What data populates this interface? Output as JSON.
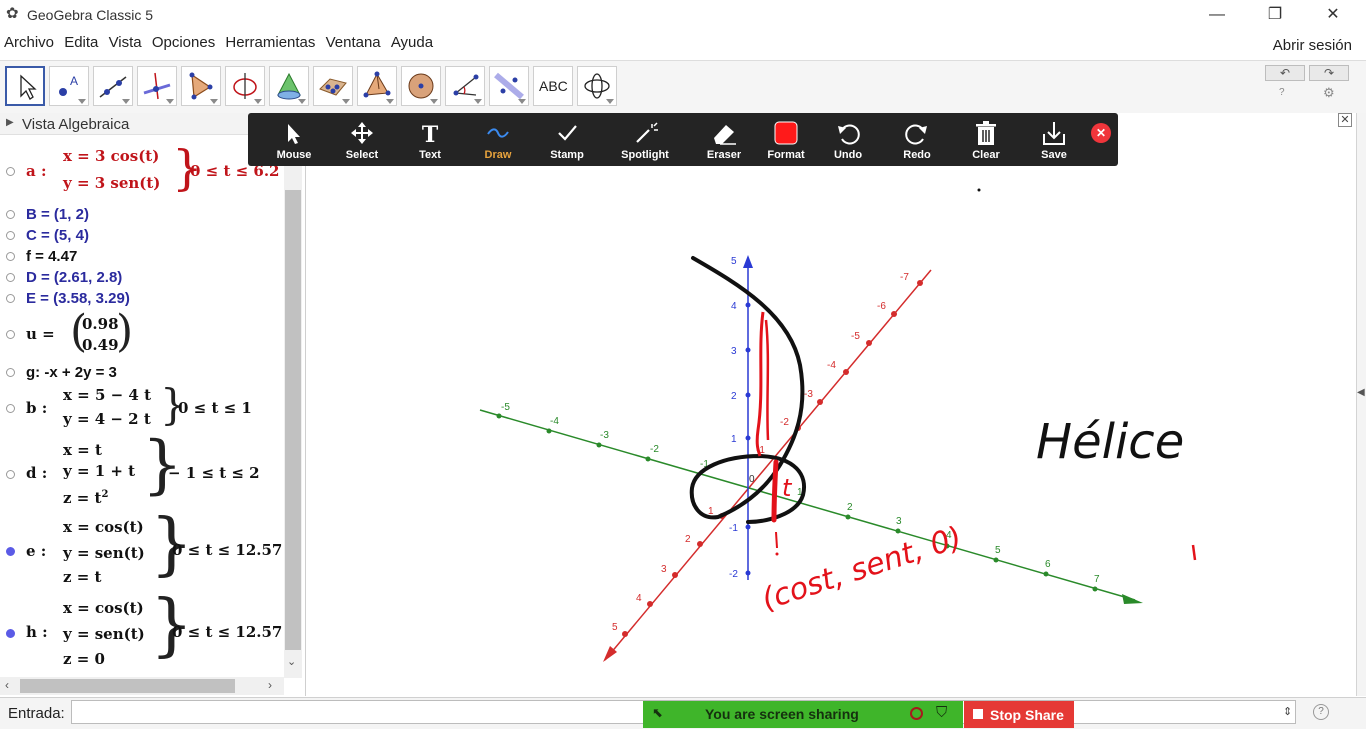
{
  "window": {
    "title": "GeoGebra Classic 5",
    "minimize": "—",
    "restore": "❐",
    "close": "✕"
  },
  "menu": {
    "items": [
      "Archivo",
      "Edita",
      "Vista",
      "Opciones",
      "Herramientas",
      "Ventana",
      "Ayuda"
    ],
    "signin": "Abrir sesión"
  },
  "toolbar": {
    "tools": [
      "move-tool",
      "point-tool",
      "line-tool",
      "perpendicular-tool",
      "polygon-tool",
      "circle-axis-tool",
      "intersect-surfaces-tool",
      "plane-tool",
      "pyramid-tool",
      "sphere-tool",
      "angle-tool",
      "reflect-tool",
      "text-tool",
      "rotate-view-tool"
    ],
    "text_tool_label": "ABC",
    "undo": "↶",
    "redo": "↷",
    "help": "?",
    "settings": "⚙"
  },
  "algebra": {
    "title": "Vista Algebraica",
    "a": {
      "label": "a :",
      "line1": "x = 3 cos(t)",
      "line2": "y = 3 sen(t)",
      "range": "0 ≤ t ≤ 6.2"
    },
    "B": "B = (1, 2)",
    "C": "C = (5, 4)",
    "f": "f = 4.47",
    "D": "D = (2.61, 2.8)",
    "E": "E = (3.58, 3.29)",
    "u": {
      "label": "u =",
      "v1": "0.98",
      "v2": "0.49"
    },
    "g": "g: -x + 2y = 3",
    "b": {
      "label": "b :",
      "line1": "x = 5 − 4 t",
      "line2": "y = 4 − 2 t",
      "range": "0 ≤ t ≤ 1"
    },
    "d": {
      "label": "d :",
      "line1": "x = t",
      "line2": "y = 1 + t",
      "line3": "z = t",
      "exp": "2",
      "range": "− 1 ≤ t ≤ 2"
    },
    "e": {
      "label": "e :",
      "line1": "x = cos(t)",
      "line2": "y = sen(t)",
      "line3": "z = t",
      "range": "0 ≤ t ≤ 12.57"
    },
    "h": {
      "label": "h :",
      "line1": "x = cos(t)",
      "line2": "y = sen(t)",
      "line3": "z = 0",
      "range": "0 ≤ t ≤ 12.57"
    }
  },
  "annotate": {
    "tools": [
      "Mouse",
      "Select",
      "Text",
      "Draw",
      "Stamp",
      "Spotlight",
      "Eraser",
      "Format",
      "Undo",
      "Redo",
      "Clear",
      "Save"
    ],
    "active": "Draw",
    "accent": "#e8a33d",
    "handwriting": {
      "title": "Hélice",
      "param": "(cost, sent, 0)",
      "t": "t"
    }
  },
  "axes": {
    "z": [
      "5",
      "4",
      "3",
      "2",
      "1",
      "-1",
      "-2"
    ],
    "x_pos": [
      "1",
      "2",
      "3",
      "4",
      "5"
    ],
    "x_neg": [
      "-1",
      "-2",
      "-3",
      "-4",
      "-5",
      "-6",
      "-7"
    ],
    "y_pos": [
      "1",
      "2",
      "3",
      "4",
      "5",
      "6",
      "7"
    ],
    "y_neg": [
      "-2",
      "-3",
      "-4",
      "-5"
    ],
    "origin": "0"
  },
  "input": {
    "label": "Entrada:",
    "value": ""
  },
  "share": {
    "status": "You are screen sharing",
    "stop": "Stop Share"
  },
  "colors": {
    "point_blue": "#2b2b9e",
    "curve_red": "#c0141a",
    "axis_green": "#2a8a2a",
    "axis_red": "#d42c2c",
    "axis_blue": "#2a3ad4",
    "ink_red": "#e3121a"
  }
}
